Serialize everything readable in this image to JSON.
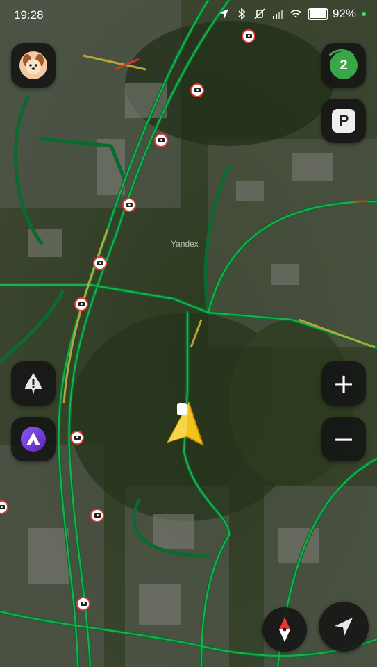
{
  "status_bar": {
    "time": "19:28",
    "battery_percent": "92%",
    "battery_level": 0.92
  },
  "map": {
    "watermark": "Yandex",
    "colors": {
      "road_green": "#0d8a3a",
      "road_yellow": "#b7a53a",
      "road_red": "#c0392b"
    }
  },
  "controls": {
    "profile_icon": "dog-avatar-icon",
    "events_counter": "2",
    "parking_label": "P",
    "zoom_in_label": "+",
    "zoom_out_label": "−"
  },
  "icons": [
    "warning-plus-icon",
    "alice-assistant-icon",
    "compass-icon",
    "navigate-arrow-icon",
    "speed-camera-icon",
    "user-location-arrow-icon"
  ]
}
